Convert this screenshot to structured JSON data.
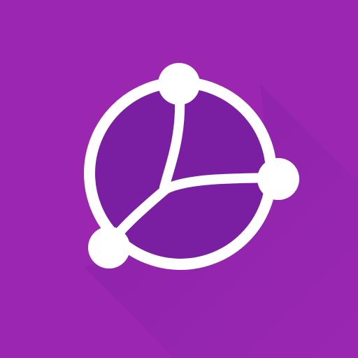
{
  "app_icon": {
    "icon": "network-globe-icon",
    "colors": {
      "background": "#9b27b0",
      "long_shadow": "#7b1fa2",
      "inner_disc": "#7b1fa2",
      "glyph": "#ffffff"
    }
  }
}
